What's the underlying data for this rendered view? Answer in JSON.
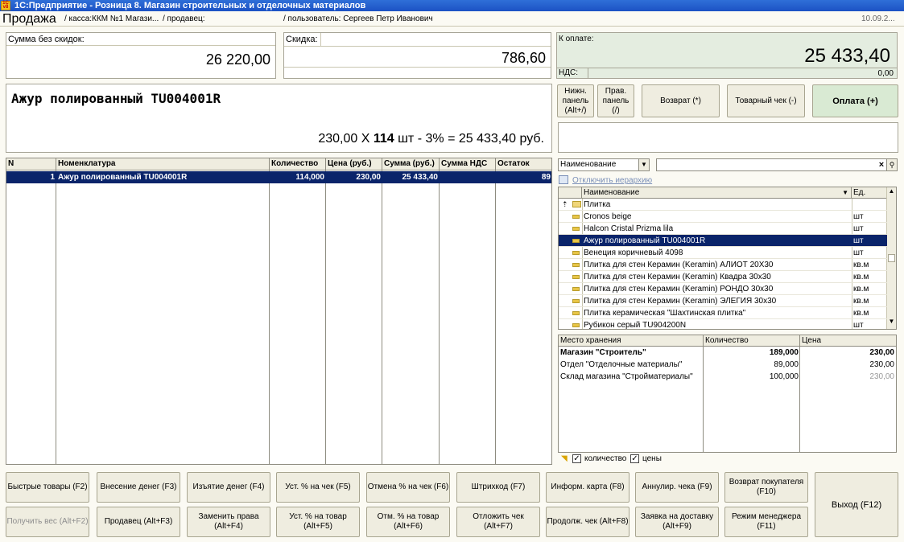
{
  "window": {
    "title": "1С:Предприятие - Розница 8. Магазин строительных и отделочных материалов",
    "app_icon": "1C-icon"
  },
  "header": {
    "form_title": "Продажа",
    "kassa": "/ касса:ККМ №1 Магази...",
    "seller": "/ продавец:",
    "user": "/ пользователь: Сергеев Петр Иванович",
    "date": "10.09.2..."
  },
  "totals": {
    "sum_no_discount_label": "Сумма без скидок:",
    "sum_no_discount": "26 220,00",
    "discount_label": "Скидка:",
    "discount": "786,60",
    "to_pay_label": "К оплате:",
    "to_pay": "25 433,40",
    "vat_label": "НДС:",
    "vat": "0,00"
  },
  "current_item": {
    "name": "Ажур полированный TU004001R",
    "price": "230,00",
    "x": "X",
    "qty": "114",
    "unit": "шт",
    "formula_rest": "- 3% = 25 433,40",
    "currency": "руб."
  },
  "top_buttons": {
    "lower_panel": "Нижн. панель (Alt+/)",
    "right_panel": "Прав. панель (/)",
    "return": "Возврат (*)",
    "receipt": "Товарный чек (-)",
    "pay": "Оплата (+)"
  },
  "grid": {
    "headers": [
      "N",
      "Номенклатура",
      "Количество",
      "Цена (руб.)",
      "Сумма (руб.)",
      "Сумма НДС",
      "Остаток"
    ],
    "rows": [
      {
        "n": "1",
        "name": "Ажур полированный TU004001R",
        "qty": "114,000",
        "price": "230,00",
        "sum": "25 433,40",
        "vat": "",
        "rest": "89"
      }
    ]
  },
  "search": {
    "field_select": "Наименование",
    "query": "",
    "disable_hierarchy": "Отключить иерархию"
  },
  "catalog": {
    "headers": [
      "Наименование",
      "Ед."
    ],
    "rows": [
      {
        "name": "Плитка",
        "unit": "",
        "folder": true
      },
      {
        "name": "Cronos beige",
        "unit": "шт"
      },
      {
        "name": "Halcon Cristal Prizma lila",
        "unit": "шт"
      },
      {
        "name": "Ажур полированный TU004001R",
        "unit": "шт",
        "selected": true
      },
      {
        "name": "Венеция коричневый 4098",
        "unit": "шт"
      },
      {
        "name": "Плитка для стен Керамин (Keramin) АЛИОТ 20X30",
        "unit": "кв.м"
      },
      {
        "name": "Плитка для стен Керамин (Keramin) Квадра 30x30",
        "unit": "кв.м"
      },
      {
        "name": "Плитка для стен Керамин (Keramin) РОНДО 30x30",
        "unit": "кв.м"
      },
      {
        "name": "Плитка для стен Керамин (Keramin) ЭЛЕГИЯ 30x30",
        "unit": "кв.м"
      },
      {
        "name": "Плитка керамическая \"Шахтинская плитка\"",
        "unit": "кв.м"
      },
      {
        "name": "Рубикон серый TU904200N",
        "unit": "шт"
      }
    ]
  },
  "stock": {
    "headers": [
      "Место хранения",
      "Количество",
      "Цена"
    ],
    "rows": [
      {
        "place": "Магазин \"Строитель\"",
        "qty": "189,000",
        "price": "230,00",
        "bold": true
      },
      {
        "place": "Отдел \"Отделочные материалы\"",
        "qty": "89,000",
        "price": "230,00"
      },
      {
        "place": "Склад магазина \"Стройматериалы\"",
        "qty": "100,000",
        "price": "230,00",
        "grey": true
      }
    ],
    "chk_qty": "количество",
    "chk_price": "цены"
  },
  "bottom_buttons": {
    "row1": [
      "Быстрые товары (F2)",
      "Внесение денег (F3)",
      "Изъятие денег (F4)",
      "Уст. % на чек (F5)",
      "Отмена % на чек (F6)",
      "Штрихкод (F7)",
      "Информ. карта (F8)",
      "Аннулир. чека (F9)",
      "Возврат покупателя (F10)"
    ],
    "row2": [
      "Получить вес (Alt+F2)",
      "Продавец (Alt+F3)",
      "Заменить права (Alt+F4)",
      "Уст. % на товар (Alt+F5)",
      "Отм. % на товар (Alt+F6)",
      "Отложить чек (Alt+F7)",
      "Продолж. чек (Alt+F8)",
      "Заявка на доставку (Alt+F9)",
      "Режим менеджера (F11)"
    ],
    "exit": "Выход (F12)"
  }
}
